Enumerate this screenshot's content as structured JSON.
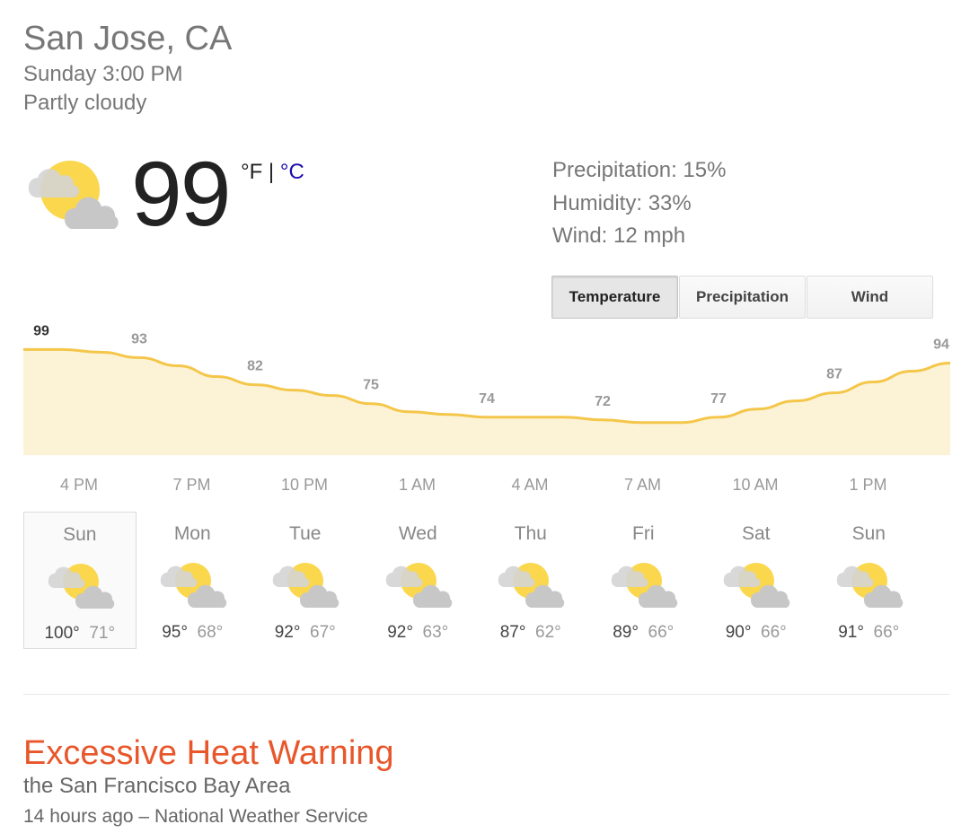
{
  "header": {
    "location": "San Jose, CA",
    "datetime": "Sunday 3:00 PM",
    "condition": "Partly cloudy"
  },
  "current": {
    "icon": "partly-cloudy-icon",
    "temp": "99",
    "unit_f": "°F",
    "unit_sep": " | ",
    "unit_c": "°C"
  },
  "details": {
    "precipitation": "Precipitation: 15%",
    "humidity": "Humidity: 33%",
    "wind": "Wind: 12 mph"
  },
  "tabs": [
    {
      "label": "Temperature",
      "active": true
    },
    {
      "label": "Precipitation",
      "active": false
    },
    {
      "label": "Wind",
      "active": false
    }
  ],
  "chart_data": {
    "type": "area",
    "x": [
      "3 PM",
      "4 PM",
      "5 PM",
      "6 PM",
      "7 PM",
      "8 PM",
      "9 PM",
      "10 PM",
      "11 PM",
      "12 AM",
      "1 AM",
      "2 AM",
      "3 AM",
      "4 AM",
      "5 AM",
      "6 AM",
      "7 AM",
      "8 AM",
      "9 AM",
      "10 AM",
      "11 AM",
      "12 PM",
      "1 PM",
      "2 PM",
      "3 PM"
    ],
    "values": [
      99,
      99,
      98,
      96,
      93,
      89,
      86,
      84,
      82,
      79,
      76,
      75,
      74,
      74,
      74,
      73,
      72,
      72,
      74,
      77,
      80,
      83,
      87,
      91,
      94
    ],
    "labels": [
      {
        "index": 0,
        "text": "99"
      },
      {
        "index": 3,
        "text": "93"
      },
      {
        "index": 6,
        "text": "82"
      },
      {
        "index": 9,
        "text": "75"
      },
      {
        "index": 12,
        "text": "74"
      },
      {
        "index": 15,
        "text": "72"
      },
      {
        "index": 18,
        "text": "77"
      },
      {
        "index": 21,
        "text": "87"
      },
      {
        "index": 24,
        "text": "94"
      }
    ],
    "tick_labels": [
      "4 PM",
      "7 PM",
      "10 PM",
      "1 AM",
      "4 AM",
      "7 AM",
      "10 AM",
      "1 PM"
    ],
    "ylim": [
      60,
      100
    ],
    "colors": {
      "line": "#f4c64a",
      "fill": "#fcf3d6",
      "label": "#999999",
      "label_current": "#333333",
      "tick": "#999999"
    }
  },
  "forecast": [
    {
      "day": "Sun",
      "hi": "100°",
      "lo": "71°",
      "icon": "partly-cloudy-icon",
      "selected": true
    },
    {
      "day": "Mon",
      "hi": "95°",
      "lo": "68°",
      "icon": "partly-cloudy-icon",
      "selected": false
    },
    {
      "day": "Tue",
      "hi": "92°",
      "lo": "67°",
      "icon": "partly-cloudy-icon",
      "selected": false
    },
    {
      "day": "Wed",
      "hi": "92°",
      "lo": "63°",
      "icon": "partly-cloudy-icon",
      "selected": false
    },
    {
      "day": "Thu",
      "hi": "87°",
      "lo": "62°",
      "icon": "partly-cloudy-icon",
      "selected": false
    },
    {
      "day": "Fri",
      "hi": "89°",
      "lo": "66°",
      "icon": "partly-cloudy-icon",
      "selected": false
    },
    {
      "day": "Sat",
      "hi": "90°",
      "lo": "66°",
      "icon": "partly-cloudy-icon",
      "selected": false
    },
    {
      "day": "Sun",
      "hi": "91°",
      "lo": "66°",
      "icon": "partly-cloudy-icon",
      "selected": false
    }
  ],
  "alert": {
    "title": "Excessive Heat Warning",
    "area": "the San Francisco Bay Area",
    "source": "14 hours ago – National Weather Service",
    "color": "#e8562a"
  }
}
